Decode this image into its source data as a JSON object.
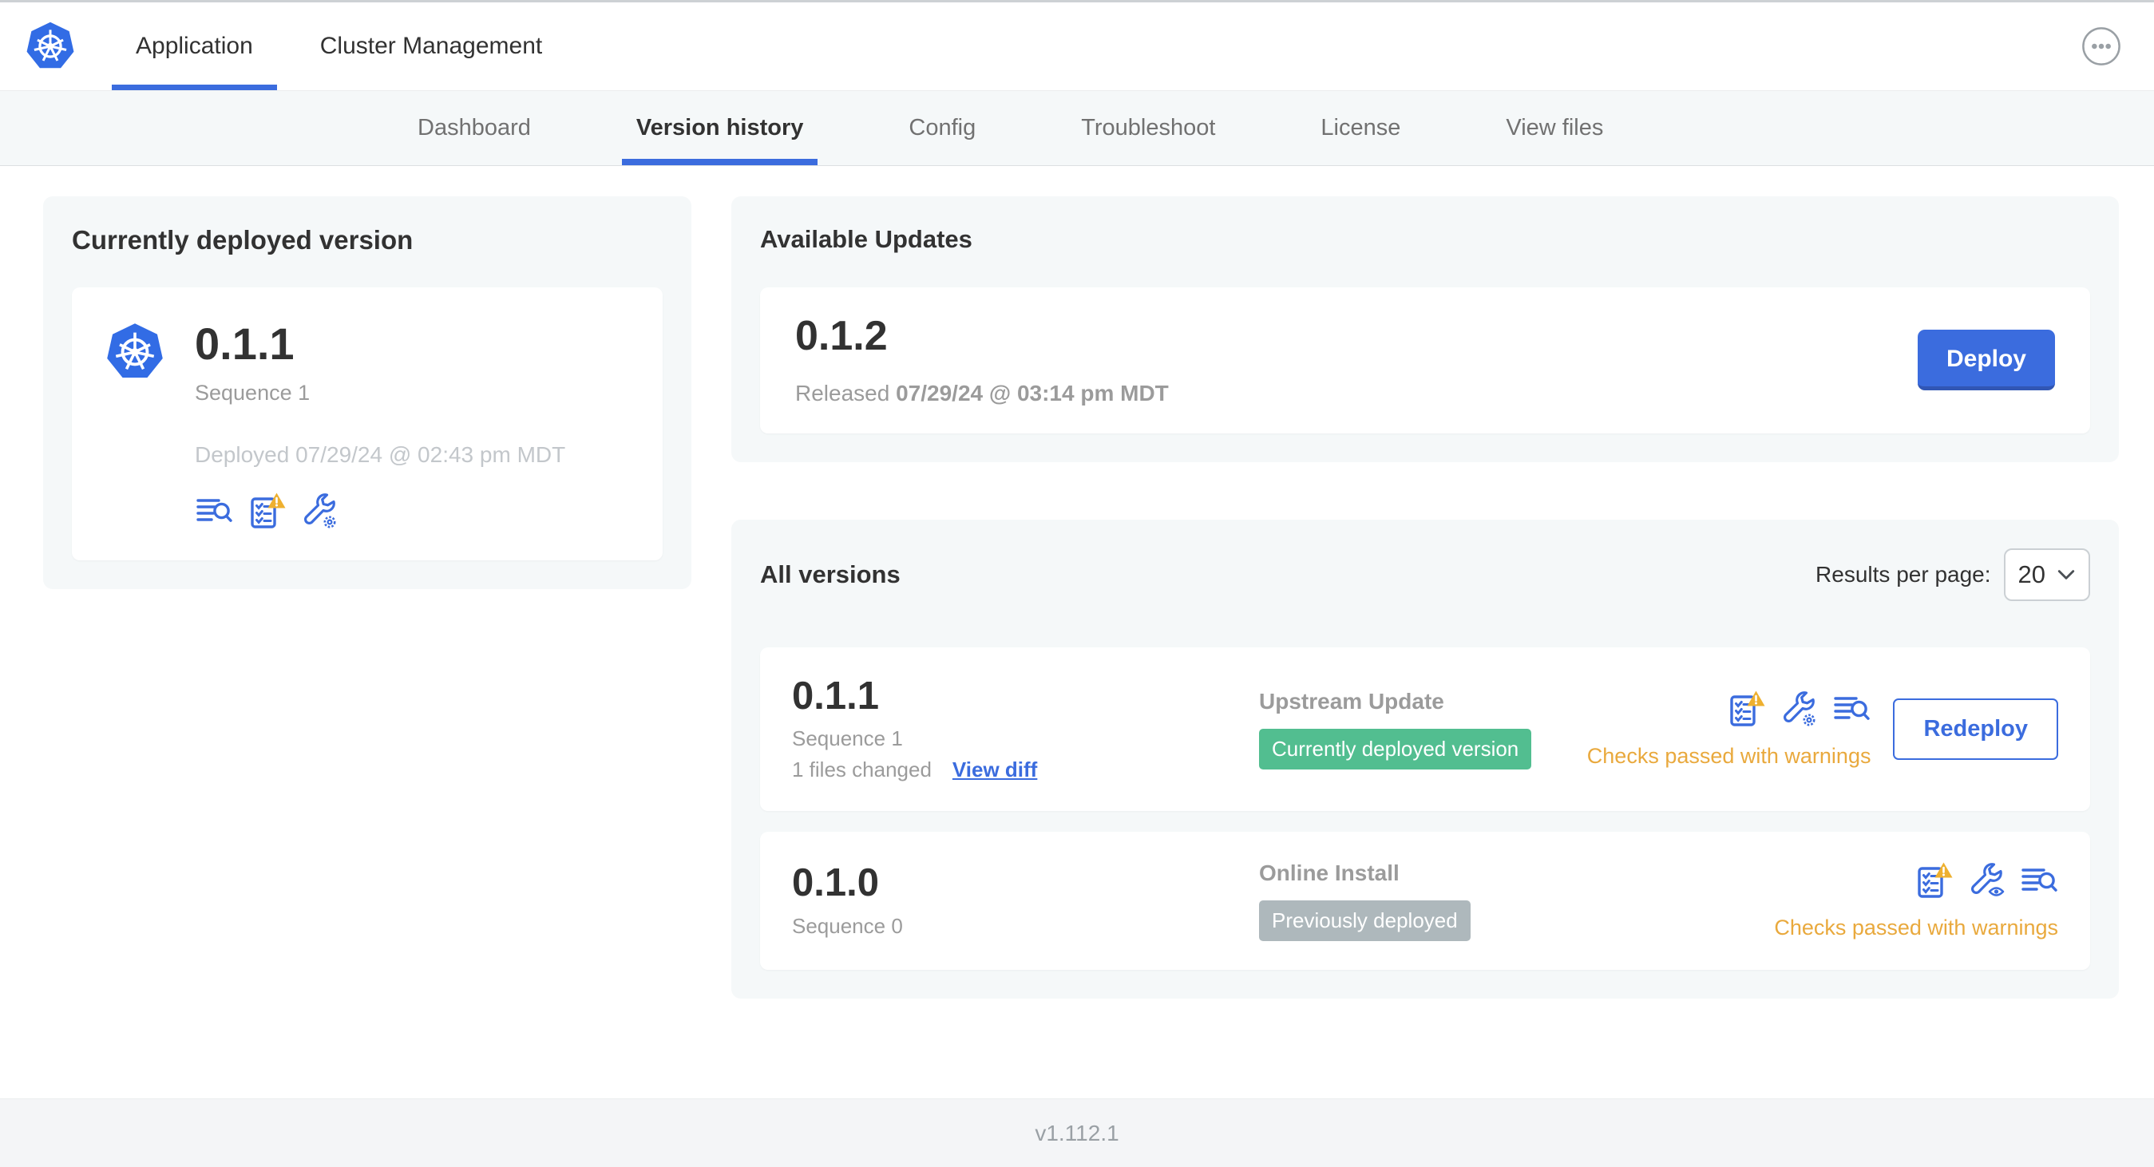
{
  "header": {
    "logo_icon": "kubernetes-logo",
    "tabs": [
      {
        "label": "Application",
        "active": true
      },
      {
        "label": "Cluster Management",
        "active": false
      }
    ],
    "overflow_menu_icon": "ellipsis-icon"
  },
  "subnav": {
    "tabs": [
      {
        "label": "Dashboard",
        "active": false
      },
      {
        "label": "Version history",
        "active": true
      },
      {
        "label": "Config",
        "active": false
      },
      {
        "label": "Troubleshoot",
        "active": false
      },
      {
        "label": "License",
        "active": false
      },
      {
        "label": "View files",
        "active": false
      }
    ]
  },
  "current_version": {
    "title": "Currently deployed version",
    "app_icon": "kubernetes-logo",
    "version": "0.1.1",
    "sequence": "Sequence 1",
    "deployed": "Deployed 07/29/24 @ 02:43 pm MDT",
    "icons": [
      "logs-icon",
      "preflight-checks-warning-icon",
      "config-gear-icon"
    ]
  },
  "available_updates": {
    "title": "Available Updates",
    "version": "0.1.2",
    "released_prefix": "Released",
    "released_date": "07/29/24 @ 03:14 pm MDT",
    "deploy_label": "Deploy"
  },
  "all_versions": {
    "title": "All versions",
    "results_per_page_label": "Results per page:",
    "results_per_page_value": "20",
    "rows": [
      {
        "version": "0.1.1",
        "sequence": "Sequence 1",
        "files_changed": "1 files changed",
        "view_diff_label": "View diff",
        "source": "Upstream Update",
        "badge": "Currently deployed version",
        "badge_bg": "#52BE90",
        "icons": [
          "preflight-checks-warning-icon",
          "config-gear-icon",
          "logs-icon"
        ],
        "status": "Checks passed with warnings",
        "action_label": "Redeploy"
      },
      {
        "version": "0.1.0",
        "sequence": "Sequence 0",
        "source": "Online Install",
        "badge": "Previously deployed",
        "badge_bg": "#AEB8BC",
        "icons": [
          "preflight-checks-warning-icon",
          "config-view-icon",
          "logs-icon"
        ],
        "status": "Checks passed with warnings"
      }
    ]
  },
  "footer": {
    "version": "v1.112.1"
  },
  "colors": {
    "accent_blue": "#3B6CDE",
    "kubernetes_blue": "#326CE5",
    "success_green": "#52BE90",
    "neutral_badge_gray": "#AEB8BC",
    "warning_amber": "#E9A93D",
    "panel_gray": "#F5F8F9"
  }
}
